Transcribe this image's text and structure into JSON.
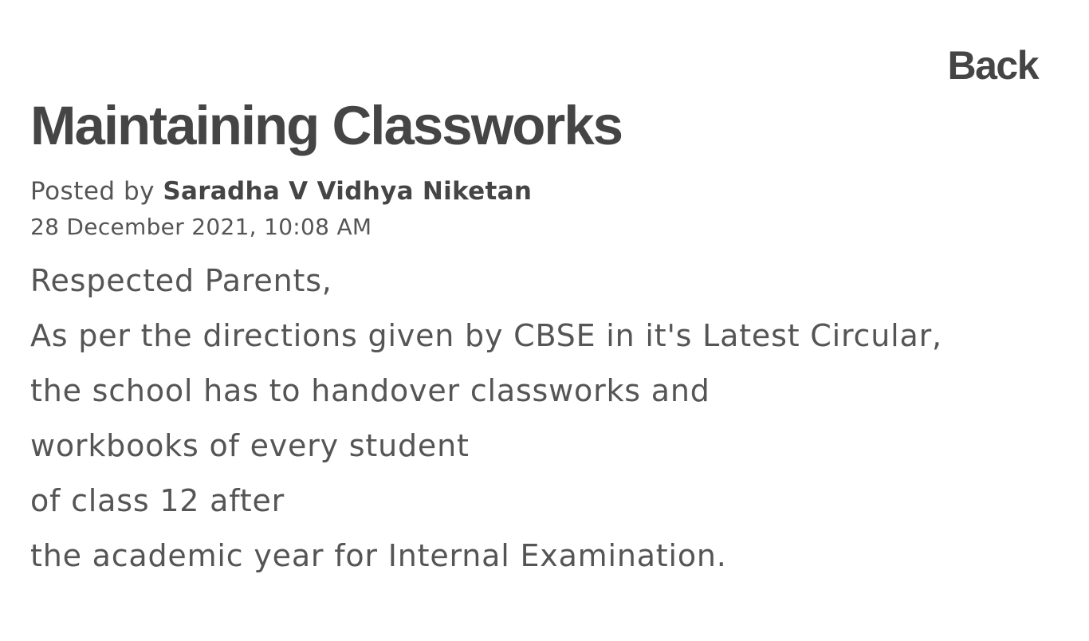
{
  "nav": {
    "back_label": "Back"
  },
  "post": {
    "title": "Maintaining Classworks",
    "posted_by_prefix": "Posted by ",
    "author": "Saradha V Vidhya Niketan",
    "date": "28 December 2021, 10:08 AM",
    "body_lines": [
      "Respected Parents,",
      "As per the directions given by CBSE in it's Latest Circular,",
      "the school has to handover classworks and",
      "workbooks of every student",
      "of class 12 after",
      "the academic year for Internal Examination."
    ]
  }
}
